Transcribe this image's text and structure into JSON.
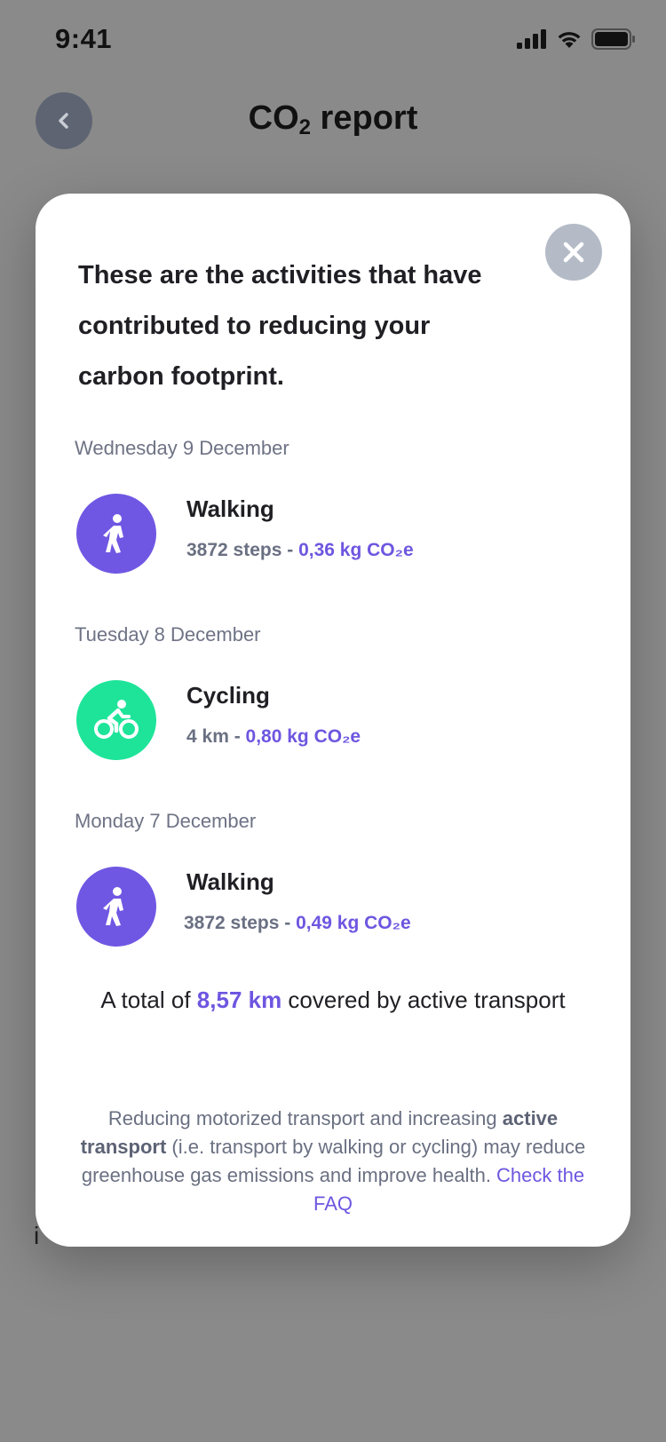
{
  "status_bar": {
    "time": "9:41"
  },
  "header": {
    "title_main": "CO",
    "title_sub": "2",
    "title_rest": " report"
  },
  "background": {
    "peek_text": "i"
  },
  "modal": {
    "heading": "These are the activities that have contributed to reducing your carbon footprint.",
    "activities": [
      {
        "date": "Wednesday 9 December",
        "name": "Walking",
        "amount": "3872 steps -",
        "co2": "0,36 kg CO₂e",
        "icon": "walking-icon",
        "color": "#7057e3"
      },
      {
        "date": "Tuesday 8 December",
        "name": "Cycling",
        "amount": "4 km -",
        "co2": "0,80 kg CO₂e",
        "icon": "cycling-icon",
        "color": "#1ee49a"
      },
      {
        "date": "Monday 7 December",
        "name": "Walking",
        "amount": "3872 steps -",
        "co2": "0,49 kg CO₂e",
        "icon": "walking-icon",
        "color": "#7057e3"
      }
    ],
    "total": {
      "prefix": "A total of ",
      "value": "8,57 km",
      "suffix": " covered by active transport"
    },
    "footnote": {
      "part1": "Reducing motorized transport and increasing ",
      "bold": "active transport",
      "part2": " (i.e. transport by walking or cycling) may reduce greenhouse gas emissions and improve health.  ",
      "link": "Check the FAQ"
    }
  },
  "colors": {
    "accent": "#6e56e0",
    "walking": "#7057e3",
    "cycling": "#1ee49a",
    "overlay": "#8a8a8a"
  }
}
